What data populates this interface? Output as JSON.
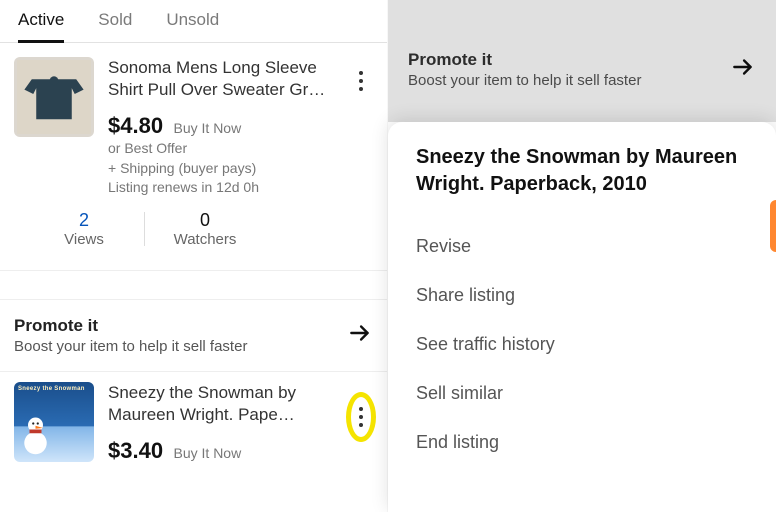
{
  "tabs": {
    "active": "Active",
    "sold": "Sold",
    "unsold": "Unsold"
  },
  "listing1": {
    "title": "Sonoma Mens Long Sleeve Shirt Pull Over Sweater Gr…",
    "price": "$4.80",
    "price_type": "Buy It Now",
    "offer": "or Best Offer",
    "shipping": "+ Shipping (buyer pays)",
    "renews": "Listing renews in 12d 0h",
    "views_num": "2",
    "views_lbl": "Views",
    "watchers_num": "0",
    "watchers_lbl": "Watchers"
  },
  "promote": {
    "title": "Promote it",
    "sub": "Boost your item to help it sell faster"
  },
  "listing2": {
    "title": "Sneezy the Snowman by Maureen Wright. Pape…",
    "price": "$3.40",
    "price_type": "Buy It Now",
    "book_label": "Sneezy the Snowman"
  },
  "sheet": {
    "title": "Sneezy the Snowman by Maureen Wright. Paperback, 2010",
    "revise": "Revise",
    "share": "Share listing",
    "traffic": "See traffic history",
    "similar": "Sell similar",
    "end": "End listing"
  }
}
